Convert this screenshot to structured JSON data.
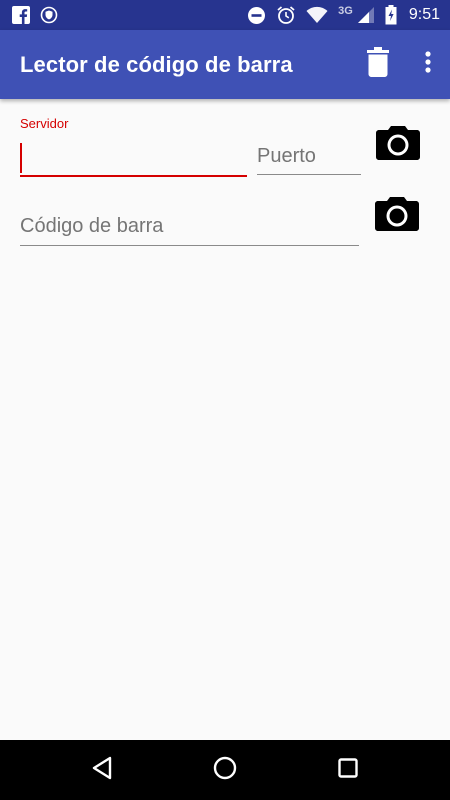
{
  "status_bar": {
    "network_label": "3G",
    "time": "9:51",
    "left_icons": [
      "facebook-icon",
      "vpn-shield-icon"
    ],
    "right_icons": [
      "do-not-disturb-icon",
      "alarm-icon",
      "wifi-icon",
      "signal-icon",
      "battery-charging-icon"
    ]
  },
  "app_bar": {
    "title": "Lector de código de barra",
    "actions": [
      "trash-icon",
      "more-vert-icon"
    ],
    "background": "#3f51b5",
    "status_background": "#27348f"
  },
  "form": {
    "server": {
      "label": "Servidor",
      "value": ""
    },
    "port": {
      "placeholder": "Puerto",
      "value": ""
    },
    "barcode": {
      "placeholder": "Código de barra",
      "value": ""
    },
    "accent_color": "#d50000"
  },
  "nav_bar": {
    "buttons": [
      "back-icon",
      "home-icon",
      "recents-icon"
    ]
  }
}
